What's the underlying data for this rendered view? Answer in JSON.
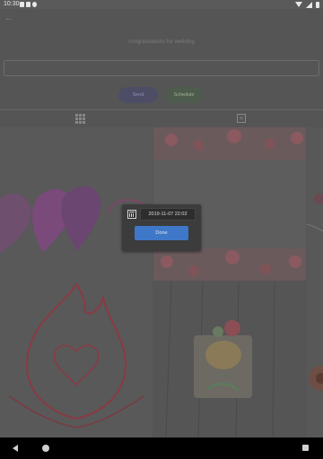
{
  "status_bar": {
    "time": "10:30",
    "icons": [
      "notification-icon",
      "sim-icon",
      "alarm-icon",
      "wifi-icon",
      "cell-signal-icon",
      "battery-icon"
    ]
  },
  "header": {
    "back_icon": "arrow-left-icon",
    "message_title": "congratulations for wedding",
    "message_input_value": ""
  },
  "actions": {
    "send_label": "Send",
    "schedule_label": "Schedule"
  },
  "tabs": {
    "grid_icon": "grid-icon",
    "add_icon": "add-icon"
  },
  "dialog": {
    "calendar_icon": "calendar-icon",
    "datetime": "2019-11-07 22:02",
    "done_label": "Done"
  },
  "colors": {
    "done_button": "#3f78c8",
    "send_button": "#4d4e66",
    "schedule_button": "#4d5c4d"
  },
  "navbar": {
    "icons": [
      "nav-back-icon",
      "nav-home-icon",
      "nav-recents-icon"
    ]
  }
}
